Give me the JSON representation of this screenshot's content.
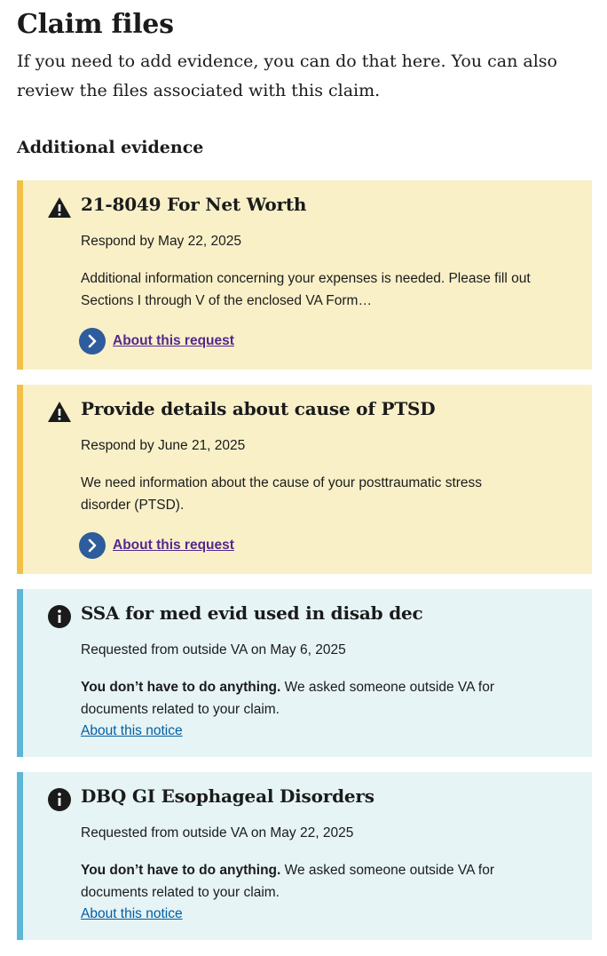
{
  "page": {
    "title": "Claim files",
    "intro": "If you need to add evidence, you can do that here. You can also review the files associated with this claim."
  },
  "additional_evidence": {
    "heading": "Additional evidence",
    "items": [
      {
        "type": "warning",
        "icon": "warning-icon",
        "title": "21-8049 For Net Worth",
        "date": "Respond by May 22, 2025",
        "description": "Additional information concerning your expenses is needed. Please fill out Sections I through V of the enclosed VA Form…",
        "link": "About this request"
      },
      {
        "type": "warning",
        "icon": "warning-icon",
        "title": "Provide details about cause of PTSD",
        "date": "Respond by June 21, 2025",
        "description": "We need information about the cause of your posttraumatic stress disorder (PTSD).",
        "link": "About this request"
      },
      {
        "type": "info",
        "icon": "info-icon",
        "title": "SSA for med evid used in disab dec",
        "date": "Requested from outside VA on May 6, 2025",
        "description_bold": "You don’t have to do anything.",
        "description": " We asked someone outside VA for documents related to your claim.",
        "link": "About this notice"
      },
      {
        "type": "info",
        "icon": "info-icon",
        "title": "DBQ GI Esophageal Disorders",
        "date": "Requested from outside VA on May 22, 2025",
        "description_bold": "You don’t have to do anything.",
        "description": " We asked someone outside VA for documents related to your claim.",
        "link": "About this notice"
      }
    ]
  },
  "colors": {
    "warning_bg": "#f9f0c8",
    "warning_border": "#f1c044",
    "info_bg": "#e6f4f6",
    "info_border": "#5bb6d8",
    "link_visited": "#54278f",
    "link": "#005ea2",
    "chevron_bg": "#2e5c9c"
  }
}
